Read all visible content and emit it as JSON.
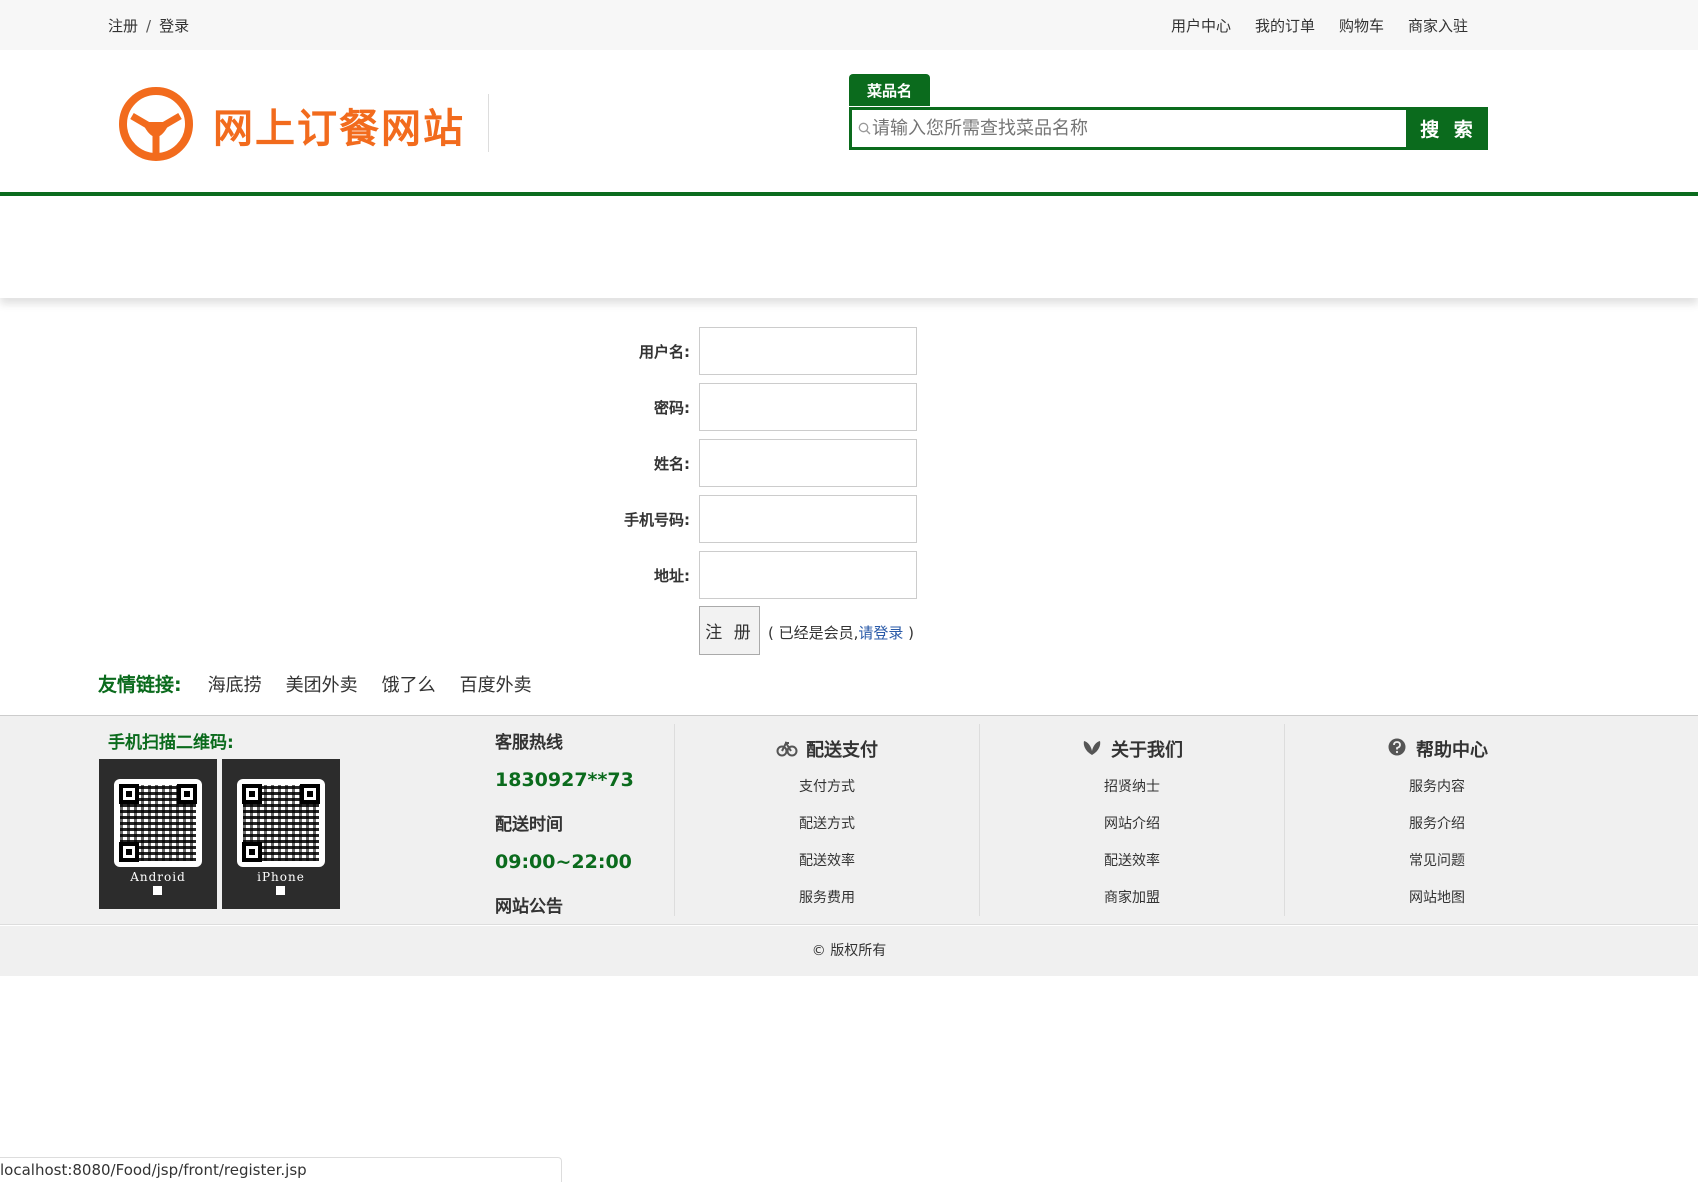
{
  "topbar": {
    "register": "注册",
    "separator": "/",
    "login": "登录",
    "nav": [
      "用户中心",
      "我的订单",
      "购物车",
      "商家入驻"
    ]
  },
  "header": {
    "site_name": "网上订餐网站",
    "brand_color": "#f26b1d",
    "accent_color": "#0b6b1d"
  },
  "search": {
    "tab": "菜品名",
    "placeholder": "请输入您所需查找菜品名称",
    "button": "搜 索"
  },
  "form": {
    "fields": [
      {
        "label": "用户名:"
      },
      {
        "label": "密码:"
      },
      {
        "label": "姓名:"
      },
      {
        "label": "手机号码:"
      },
      {
        "label": "地址:"
      }
    ],
    "submit": "注 册",
    "note_prefix": "( 已经是会员,",
    "note_link": "请登录",
    "note_suffix": " )"
  },
  "friend_links": {
    "title": "友情链接:",
    "items": [
      "海底捞",
      "美团外卖",
      "饿了么",
      "百度外卖"
    ]
  },
  "footer": {
    "qr_title": "手机扫描二维码:",
    "qr_codes": [
      {
        "label": "Android"
      },
      {
        "label": "iPhone"
      }
    ],
    "hotline_title": "客服热线",
    "hotline": "1830927**73",
    "delivery_title": "配送时间",
    "delivery_time": "09:00~22:00",
    "notice_title": "网站公告",
    "columns": [
      {
        "title": "配送支付",
        "icon": "bike-icon",
        "items": [
          "支付方式",
          "配送方式",
          "配送效率",
          "服务费用"
        ]
      },
      {
        "title": "关于我们",
        "icon": "leaf-icon",
        "items": [
          "招贤纳士",
          "网站介绍",
          "配送效率",
          "商家加盟"
        ]
      },
      {
        "title": "帮助中心",
        "icon": "help-icon",
        "items": [
          "服务内容",
          "服务介绍",
          "常见问题",
          "网站地图"
        ]
      }
    ],
    "copyright": "© 版权所有"
  },
  "statusbar": {
    "url": "localhost:8080/Food/jsp/front/register.jsp"
  }
}
